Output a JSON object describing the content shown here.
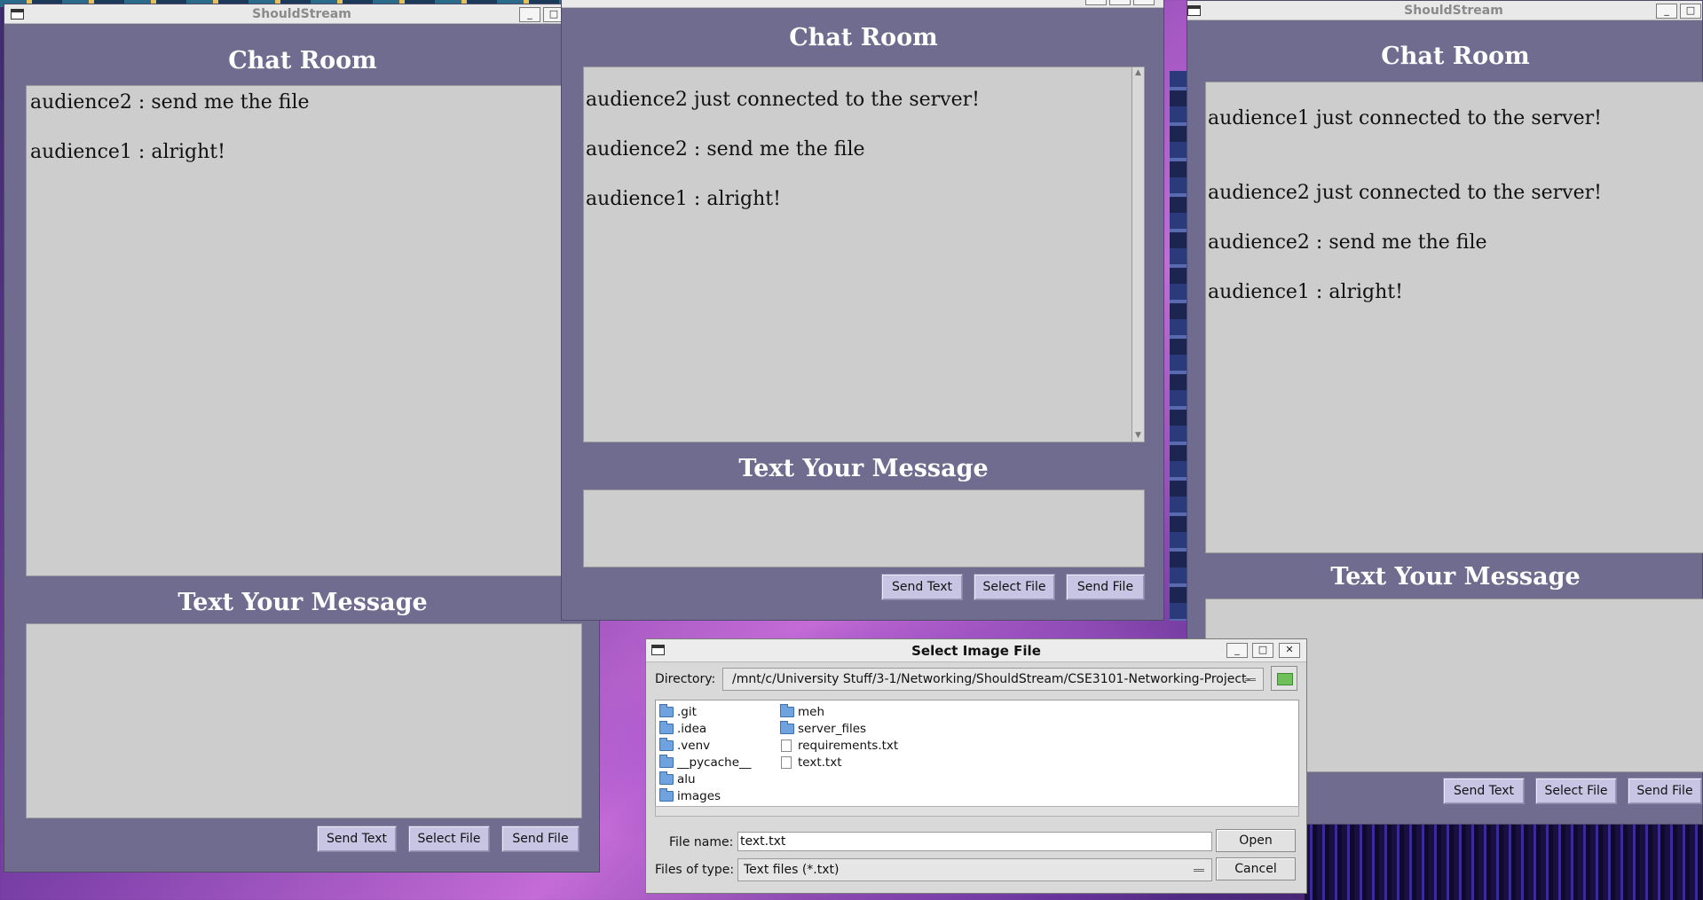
{
  "window_left": {
    "title": "ShouldStream",
    "chat_heading": "Chat Room",
    "messages": [
      "audience2 : send me the file",
      "audience1 : alright!"
    ],
    "message_heading": "Text Your Message",
    "buttons": {
      "send_text": "Send Text",
      "select_file": "Select File",
      "send_file": "Send File"
    }
  },
  "window_middle": {
    "chat_heading": "Chat Room",
    "messages": [
      "audience2 just connected to the server!",
      "audience2 : send me the file",
      "audience1 : alright!"
    ],
    "message_heading": "Text Your Message",
    "buttons": {
      "send_text": "Send Text",
      "select_file": "Select File",
      "send_file": "Send File"
    }
  },
  "window_right": {
    "title": "ShouldStream",
    "chat_heading": "Chat Room",
    "messages": [
      "audience1 just connected to the server!",
      "audience2 just connected to the server!",
      "audience2 : send me the file",
      "audience1 : alright!"
    ],
    "message_heading": "Text Your Message",
    "buttons": {
      "send_text": "Send Text",
      "select_file": "Select File",
      "send_file": "Send File"
    }
  },
  "dialog": {
    "title": "Select Image File",
    "directory_label": "Directory:",
    "directory_value": "/mnt/c/University Stuff/3-1/Networking/ShouldStream/CSE3101-Networking-Project-",
    "files_col1": [
      {
        "name": ".git",
        "kind": "folder"
      },
      {
        "name": ".idea",
        "kind": "folder"
      },
      {
        "name": ".venv",
        "kind": "folder"
      },
      {
        "name": "__pycache__",
        "kind": "folder"
      },
      {
        "name": "alu",
        "kind": "folder"
      },
      {
        "name": "images",
        "kind": "folder"
      }
    ],
    "files_col2": [
      {
        "name": "meh",
        "kind": "folder"
      },
      {
        "name": "server_files",
        "kind": "folder"
      },
      {
        "name": "requirements.txt",
        "kind": "file"
      },
      {
        "name": "text.txt",
        "kind": "file"
      }
    ],
    "filename_label": "File name:",
    "filename_value": "text.txt",
    "filetype_label": "Files of type:",
    "filetype_value": "Text files (*.txt)",
    "open_label": "Open",
    "cancel_label": "Cancel",
    "close_glyph": "✕",
    "minimize_glyph": "_",
    "maximize_glyph": "□"
  }
}
